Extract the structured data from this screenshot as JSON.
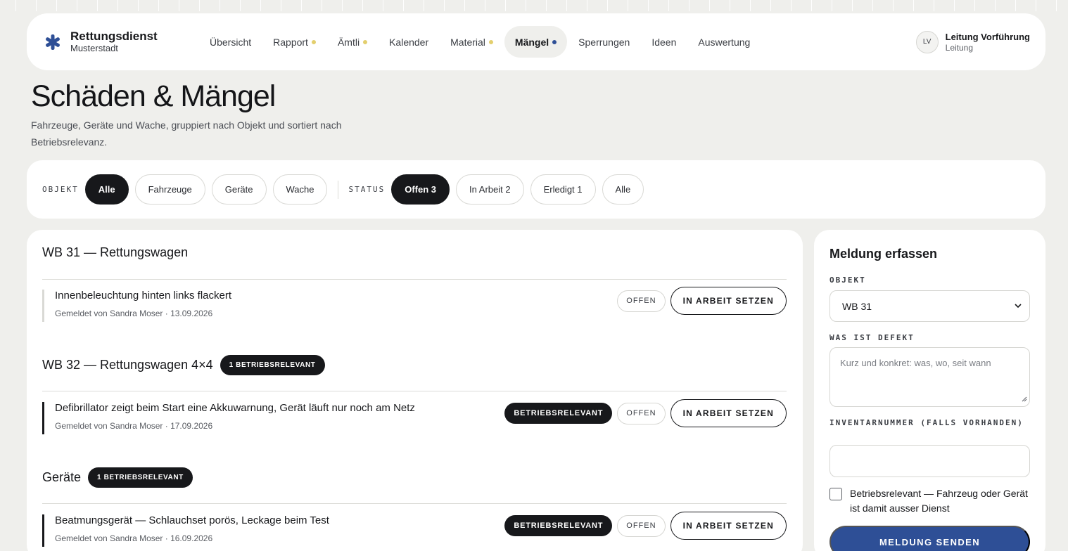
{
  "brand": {
    "name": "Rettungsdienst",
    "sub": "Musterstadt"
  },
  "nav": [
    {
      "label": "Übersicht",
      "dot": null
    },
    {
      "label": "Rapport",
      "dot": "yellow"
    },
    {
      "label": "Ämtli",
      "dot": "yellow"
    },
    {
      "label": "Kalender",
      "dot": null
    },
    {
      "label": "Material",
      "dot": "yellow"
    },
    {
      "label": "Mängel",
      "dot": "blue",
      "active": true
    },
    {
      "label": "Sperrungen",
      "dot": null
    },
    {
      "label": "Ideen",
      "dot": null
    },
    {
      "label": "Auswertung",
      "dot": null
    }
  ],
  "user": {
    "initials": "LV",
    "name": "Leitung Vorführung",
    "role": "Leitung"
  },
  "page": {
    "title": "Schäden & Mängel",
    "subtitle": "Fahrzeuge, Geräte und Wache, gruppiert nach Objekt und sortiert nach Betriebsrelevanz."
  },
  "filters": {
    "objekt_label": "OBJEKT",
    "objekt": [
      {
        "label": "Alle",
        "active": true
      },
      {
        "label": "Fahrzeuge"
      },
      {
        "label": "Geräte"
      },
      {
        "label": "Wache"
      }
    ],
    "status_label": "STATUS",
    "status": [
      {
        "label": "Offen 3",
        "active": true
      },
      {
        "label": "In Arbeit 2"
      },
      {
        "label": "Erledigt 1"
      },
      {
        "label": "Alle"
      }
    ]
  },
  "groups": [
    {
      "title": "WB 31 — Rettungswagen",
      "badge": null,
      "items": [
        {
          "title": "Innenbeleuchtung hinten links flackert",
          "meta": "Gemeldet von Sandra Moser · 13.09.2026",
          "relevant": false,
          "status": "OFFEN",
          "action": "IN ARBEIT SETZEN"
        }
      ]
    },
    {
      "title": "WB 32 — Rettungswagen 4×4",
      "badge": "1 BETRIEBSRELEVANT",
      "items": [
        {
          "title": "Defibrillator zeigt beim Start eine Akkuwarnung, Gerät läuft nur noch am Netz",
          "meta": "Gemeldet von Sandra Moser · 17.09.2026",
          "relevant": true,
          "relevant_label": "BETRIEBSRELEVANT",
          "status": "OFFEN",
          "action": "IN ARBEIT SETZEN"
        }
      ]
    },
    {
      "title": "Geräte",
      "badge": "1 BETRIEBSRELEVANT",
      "items": [
        {
          "title": "Beatmungsgerät — Schlauchset porös, Leckage beim Test",
          "meta": "Gemeldet von Sandra Moser · 16.09.2026",
          "relevant": true,
          "relevant_label": "BETRIEBSRELEVANT",
          "status": "OFFEN",
          "action": "IN ARBEIT SETZEN"
        }
      ]
    }
  ],
  "form": {
    "title": "Meldung erfassen",
    "objekt_label": "OBJEKT",
    "objekt_value": "WB 31",
    "defekt_label": "WAS IST DEFEKT",
    "defekt_placeholder": "Kurz und konkret: was, wo, seit wann",
    "inventar_label": "INVENTARNUMMER (FALLS VORHANDEN)",
    "inventar_value": "",
    "checkbox_label": "Betriebsrelevant — Fahrzeug oder Gerät ist damit ausser Dienst",
    "submit_label": "MELDUNG SENDEN"
  },
  "colors": {
    "accent": "#2e4f96",
    "dark": "#17181b",
    "background": "#efefec",
    "dot_yellow": "#e3cf6e"
  }
}
